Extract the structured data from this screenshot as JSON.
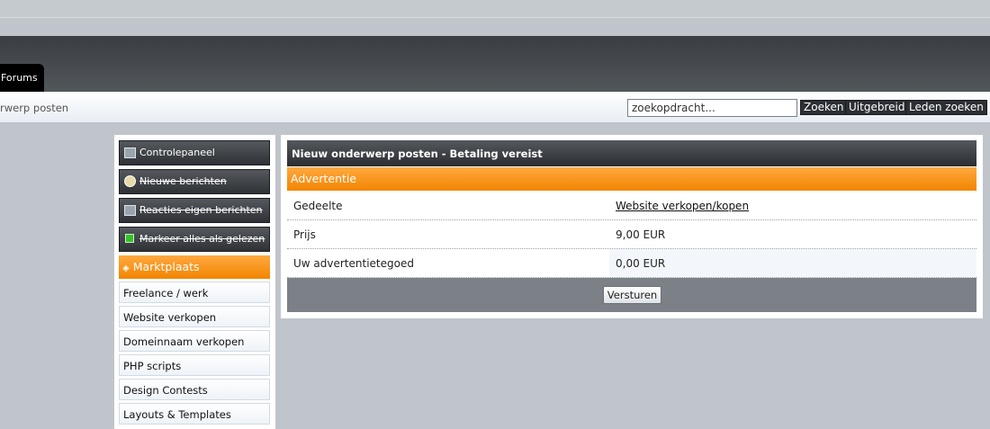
{
  "header": {
    "forums_tab": "Forums"
  },
  "navbar": {
    "breadcrumb": "rwerp posten",
    "search_value": "zoekopdracht...",
    "search_button": "Zoeken",
    "advanced_button": "Uitgebreid",
    "members_button": "Leden zoeken"
  },
  "sidebar": {
    "control_items": [
      {
        "label": "Controlepaneel",
        "icon": "control-panel-icon"
      },
      {
        "label": "Nieuwe berichten",
        "icon": "clock-icon"
      },
      {
        "label": "Reacties eigen berichten",
        "icon": "replies-icon"
      },
      {
        "label": "Markeer alles als gelezen",
        "icon": "mark-read-icon"
      }
    ],
    "market_header": "Marktplaats",
    "categories": [
      "Freelance / werk",
      "Website verkopen",
      "Domeinnaam verkopen",
      "PHP scripts",
      "Design Contests",
      "Layouts & Templates"
    ]
  },
  "main": {
    "title": "Nieuw onderwerp posten - Betaling vereist",
    "section": "Advertentie",
    "rows": [
      {
        "label": "Gedeelte",
        "value": "Website verkopen/kopen"
      },
      {
        "label": "Prijs",
        "value": "9,00 EUR"
      },
      {
        "label": "Uw advertentietegoed",
        "value": "0,00 EUR"
      }
    ],
    "submit": "Versturen"
  },
  "colors": {
    "accent_orange": "#f28500",
    "dark_header": "#3a3d41"
  }
}
